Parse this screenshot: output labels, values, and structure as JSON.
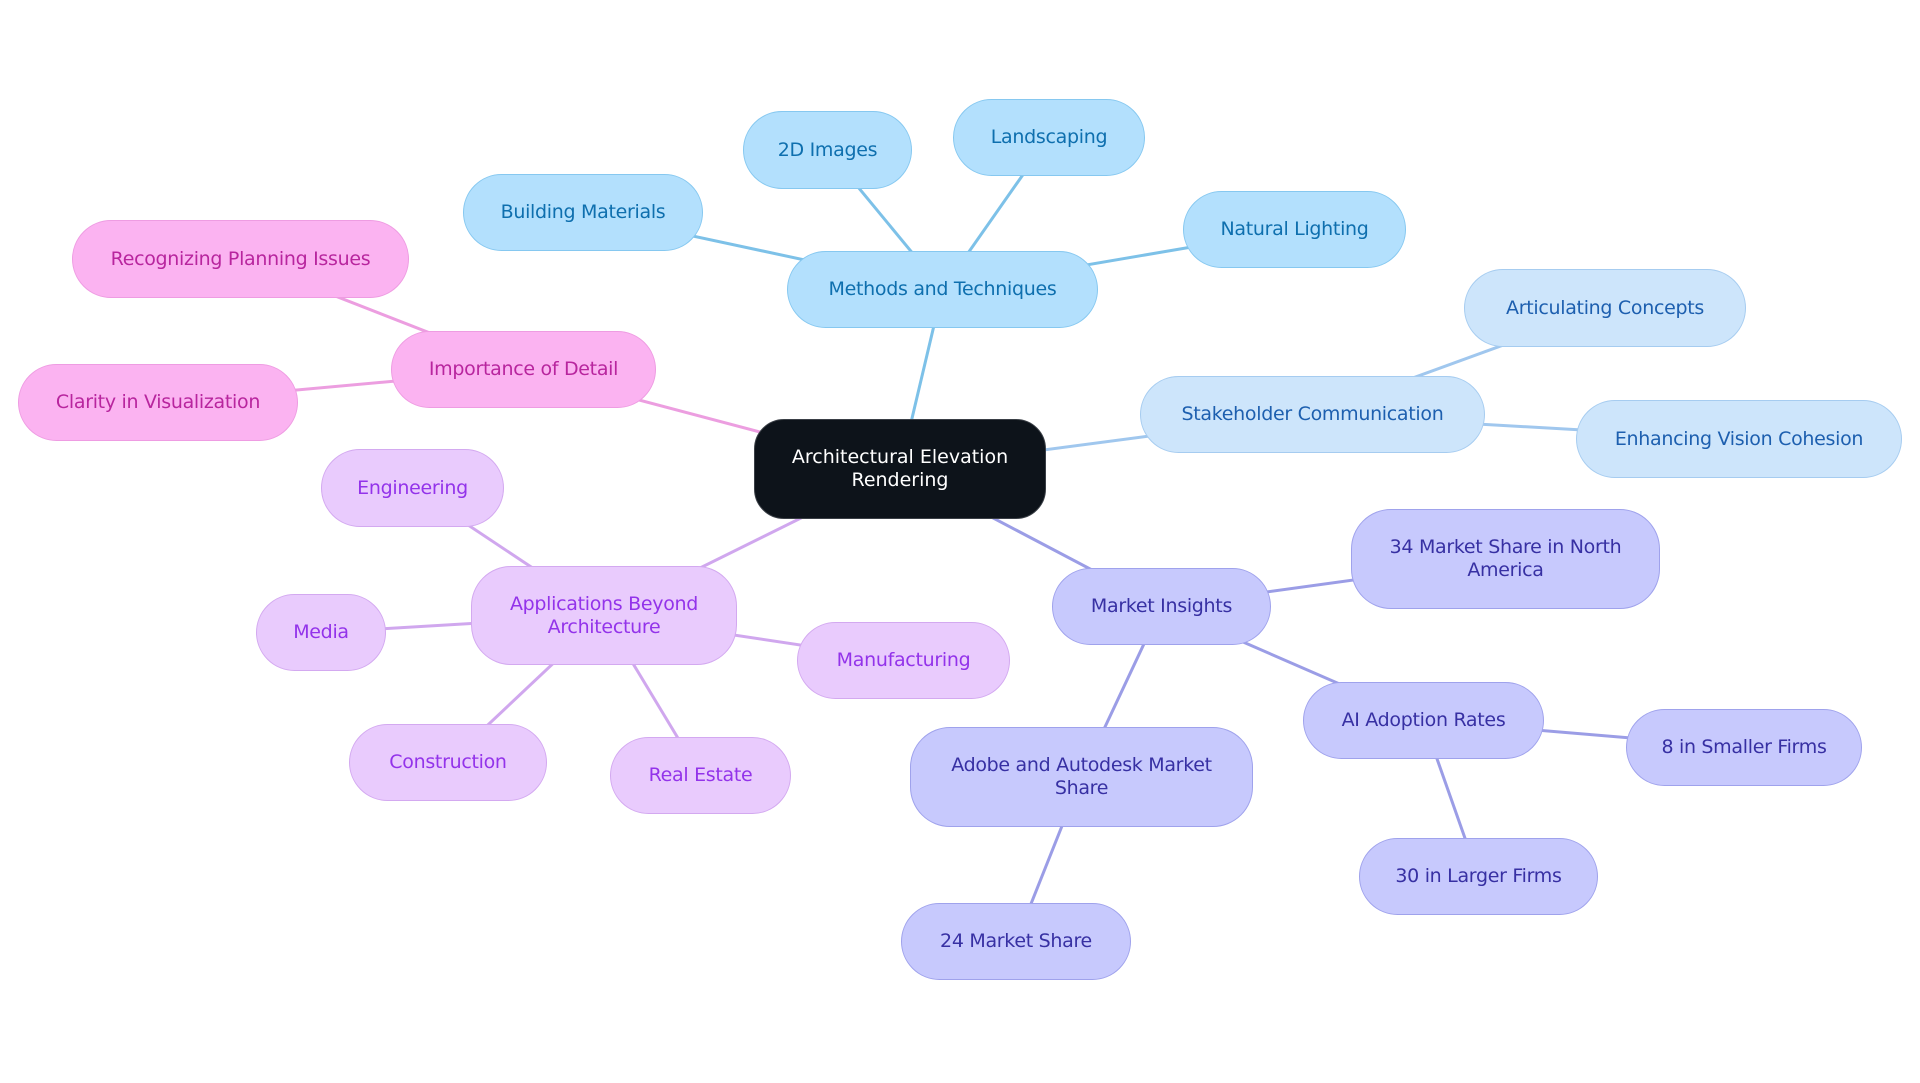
{
  "title": "Architectural Elevation Rendering",
  "themes": {
    "root": {
      "fill": "#0D131A",
      "stroke": "#3A3F46",
      "text": "#FFFFFF",
      "line": "#7DC1E8"
    },
    "blue": {
      "fill": "#B3E0FD",
      "stroke": "#86C8F0",
      "text": "#0E6FAE",
      "line": "#7DC1E8"
    },
    "lightblue": {
      "fill": "#CDE5FB",
      "stroke": "#A6CCF0",
      "text": "#1D5FAF",
      "line": "#A0C7EE"
    },
    "indigo": {
      "fill": "#C7C9FD",
      "stroke": "#9FA2EC",
      "text": "#3730A3",
      "line": "#9B9DE6"
    },
    "lavender": {
      "fill": "#E9CBFD",
      "stroke": "#D3A9F0",
      "text": "#9333EA",
      "line": "#D0A7EE"
    },
    "pink": {
      "fill": "#FBB3F1",
      "stroke": "#EE9CE2",
      "text": "#B8259E",
      "line": "#EC9EE0"
    }
  },
  "nodes": [
    {
      "id": "root",
      "label": "Architectural Elevation\nRendering",
      "theme": "root",
      "parent": null
    },
    {
      "id": "methods",
      "label": "Methods and Techniques",
      "theme": "blue",
      "parent": "root"
    },
    {
      "id": "building-materials",
      "label": "Building Materials",
      "theme": "blue",
      "parent": "methods"
    },
    {
      "id": "2d-images",
      "label": "2D Images",
      "theme": "blue",
      "parent": "methods"
    },
    {
      "id": "landscaping",
      "label": "Landscaping",
      "theme": "blue",
      "parent": "methods"
    },
    {
      "id": "natural-lighting",
      "label": "Natural Lighting",
      "theme": "blue",
      "parent": "methods"
    },
    {
      "id": "stakeholder",
      "label": "Stakeholder Communication",
      "theme": "lightblue",
      "parent": "root"
    },
    {
      "id": "articulating",
      "label": "Articulating Concepts",
      "theme": "lightblue",
      "parent": "stakeholder"
    },
    {
      "id": "enhancing",
      "label": "Enhancing Vision Cohesion",
      "theme": "lightblue",
      "parent": "stakeholder"
    },
    {
      "id": "market",
      "label": "Market Insights",
      "theme": "indigo",
      "parent": "root"
    },
    {
      "id": "na-share",
      "label": "34 Market Share in North\nAmerica",
      "theme": "indigo",
      "parent": "market"
    },
    {
      "id": "ai-adoption",
      "label": "AI Adoption Rates",
      "theme": "indigo",
      "parent": "market"
    },
    {
      "id": "smaller-firms",
      "label": "8 in Smaller Firms",
      "theme": "indigo",
      "parent": "ai-adoption"
    },
    {
      "id": "larger-firms",
      "label": "30 in Larger Firms",
      "theme": "indigo",
      "parent": "ai-adoption"
    },
    {
      "id": "adobe-autodesk",
      "label": "Adobe and Autodesk Market\nShare",
      "theme": "indigo",
      "parent": "market"
    },
    {
      "id": "24-share",
      "label": "24 Market Share",
      "theme": "indigo",
      "parent": "adobe-autodesk"
    },
    {
      "id": "applications",
      "label": "Applications Beyond\nArchitecture",
      "theme": "lavender",
      "parent": "root"
    },
    {
      "id": "engineering",
      "label": "Engineering",
      "theme": "lavender",
      "parent": "applications"
    },
    {
      "id": "media",
      "label": "Media",
      "theme": "lavender",
      "parent": "applications"
    },
    {
      "id": "manufacturing",
      "label": "Manufacturing",
      "theme": "lavender",
      "parent": "applications"
    },
    {
      "id": "construction",
      "label": "Construction",
      "theme": "lavender",
      "parent": "applications"
    },
    {
      "id": "real-estate",
      "label": "Real Estate",
      "theme": "lavender",
      "parent": "applications"
    },
    {
      "id": "importance",
      "label": "Importance of Detail",
      "theme": "pink",
      "parent": "root"
    },
    {
      "id": "planning-issues",
      "label": "Recognizing Planning Issues",
      "theme": "pink",
      "parent": "importance"
    },
    {
      "id": "clarity",
      "label": "Clarity in Visualization",
      "theme": "pink",
      "parent": "importance"
    }
  ]
}
